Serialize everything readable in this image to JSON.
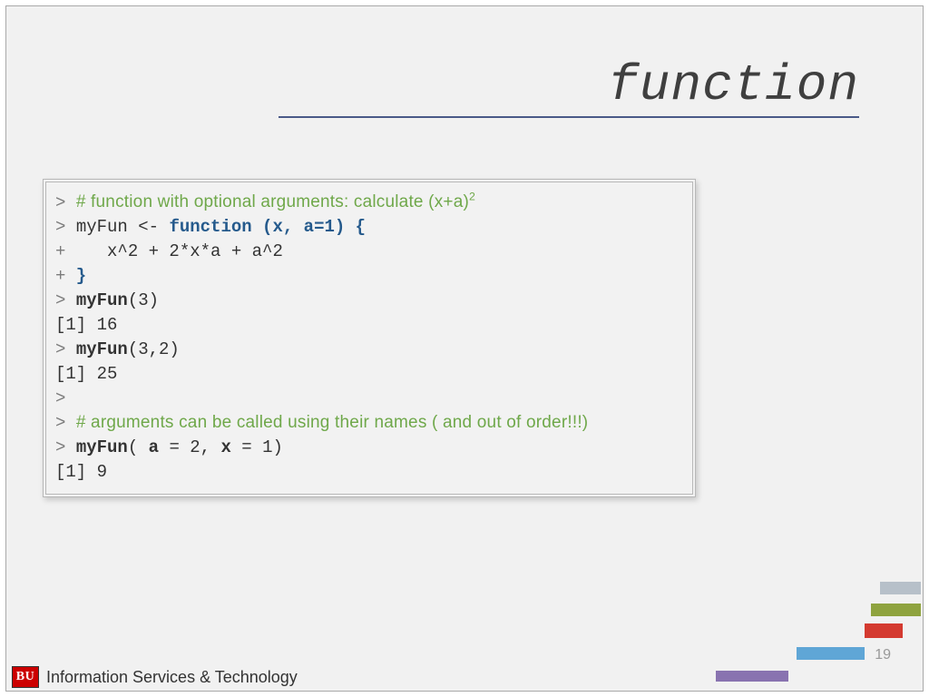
{
  "title": "function",
  "code": {
    "l1_prompt": ">",
    "l1_comment_a": "# function with optional arguments: calculate (x+a)",
    "l1_comment_sup": "2",
    "l2_prompt": ">",
    "l2_a": "myFun <- ",
    "l2_kw": "function",
    "l2_b": " (x, a=1) {",
    "l3_prompt": "+",
    "l3_body": "    x^2 + 2*x*a + a^2",
    "l4_prompt": "+",
    "l4_body": " }",
    "l5_prompt": ">",
    "l5_call_a": " ",
    "l5_call_fn": "myFun",
    "l5_call_b": "(3)",
    "l6_res": "[1] 16",
    "l7_prompt": ">",
    "l7_call_fn": "myFun",
    "l7_call_b": "(3,2)",
    "l8_res": "[1] 25",
    "l9_prompt": ">",
    "l10_prompt": ">",
    "l10_comment": "# arguments can be called using their names ( and out of order!!!)",
    "l11_prompt": ">",
    "l11_fn": "myFun",
    "l11_a": "( ",
    "l11_arg1": "a",
    "l11_b": " = 2, ",
    "l11_arg2": "x",
    "l11_c": " = 1)",
    "l12_res": "[1] 9"
  },
  "footer": {
    "badge": "BU",
    "text": "Information Services & Technology",
    "page": "19"
  }
}
